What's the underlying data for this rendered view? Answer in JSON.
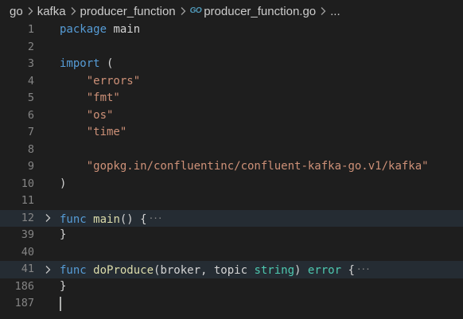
{
  "breadcrumb": {
    "items": [
      "go",
      "kafka",
      "producer_function"
    ],
    "file_icon": "GO",
    "file": "producer_function.go",
    "more": "..."
  },
  "editor": {
    "lines": [
      {
        "n": "1",
        "tokens": [
          {
            "t": "package",
            "c": "kw"
          },
          {
            "t": " main",
            "c": "plain"
          }
        ]
      },
      {
        "n": "2",
        "tokens": []
      },
      {
        "n": "3",
        "tokens": [
          {
            "t": "import",
            "c": "kw"
          },
          {
            "t": " (",
            "c": "plain"
          }
        ]
      },
      {
        "n": "4",
        "tokens": [
          {
            "t": "    ",
            "c": "plain"
          },
          {
            "t": "\"errors\"",
            "c": "str"
          }
        ]
      },
      {
        "n": "5",
        "tokens": [
          {
            "t": "    ",
            "c": "plain"
          },
          {
            "t": "\"fmt\"",
            "c": "str"
          }
        ]
      },
      {
        "n": "6",
        "tokens": [
          {
            "t": "    ",
            "c": "plain"
          },
          {
            "t": "\"os\"",
            "c": "str"
          }
        ]
      },
      {
        "n": "7",
        "tokens": [
          {
            "t": "    ",
            "c": "plain"
          },
          {
            "t": "\"time\"",
            "c": "str"
          }
        ]
      },
      {
        "n": "8",
        "tokens": []
      },
      {
        "n": "9",
        "tokens": [
          {
            "t": "    ",
            "c": "plain"
          },
          {
            "t": "\"gopkg.in/confluentinc/confluent-kafka-go.v1/kafka\"",
            "c": "str"
          }
        ]
      },
      {
        "n": "10",
        "tokens": [
          {
            "t": ")",
            "c": "plain"
          }
        ]
      },
      {
        "n": "11",
        "tokens": []
      },
      {
        "n": "12",
        "folded": true,
        "tokens": [
          {
            "t": "func",
            "c": "kw"
          },
          {
            "t": " ",
            "c": "plain"
          },
          {
            "t": "main",
            "c": "fn"
          },
          {
            "t": "() {",
            "c": "plain"
          }
        ]
      },
      {
        "n": "39",
        "tokens": [
          {
            "t": "}",
            "c": "plain"
          }
        ]
      },
      {
        "n": "40",
        "tokens": []
      },
      {
        "n": "41",
        "folded": true,
        "tokens": [
          {
            "t": "func",
            "c": "kw"
          },
          {
            "t": " ",
            "c": "plain"
          },
          {
            "t": "doProduce",
            "c": "fn"
          },
          {
            "t": "(broker, topic ",
            "c": "plain"
          },
          {
            "t": "string",
            "c": "ty"
          },
          {
            "t": ") ",
            "c": "plain"
          },
          {
            "t": "error",
            "c": "ty"
          },
          {
            "t": " {",
            "c": "plain"
          }
        ]
      },
      {
        "n": "186",
        "tokens": [
          {
            "t": "}",
            "c": "plain"
          }
        ]
      },
      {
        "n": "187",
        "tokens": [],
        "cursor": true
      }
    ],
    "fold_ellipsis": "···"
  }
}
